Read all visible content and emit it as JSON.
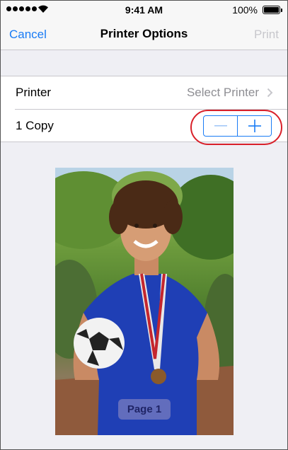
{
  "status_bar": {
    "time": "9:41 AM",
    "battery": "100%"
  },
  "nav": {
    "cancel_label": "Cancel",
    "title": "Printer Options",
    "print_label": "Print"
  },
  "options": {
    "printer_label": "Printer",
    "printer_value": "Select Printer",
    "copies_label": "1 Copy"
  },
  "preview": {
    "page_label": "Page 1"
  },
  "colors": {
    "accent": "#1a7cf5",
    "disabled": "#c7c7cc",
    "highlight": "#d9202a"
  }
}
